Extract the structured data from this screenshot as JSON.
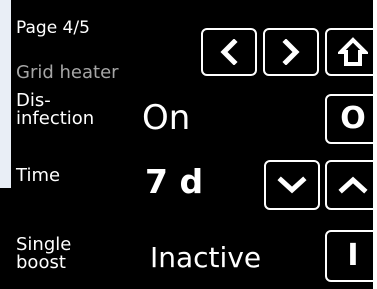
{
  "header": {
    "page_indicator": "Page 4/5",
    "title": "Grid heater"
  },
  "nav": {
    "prev_icon": "chevron-left-icon",
    "next_icon": "chevron-right-icon",
    "home_icon": "home-icon"
  },
  "settings": {
    "disinfection": {
      "label": "Dis-\ninfection",
      "value": "On",
      "button_label": "O"
    },
    "time": {
      "label": "Time",
      "value": "7 d",
      "decrease_icon": "chevron-down-icon",
      "increase_icon": "chevron-up-icon"
    },
    "single_boost": {
      "label": "Single\nboost",
      "value": "Inactive",
      "button_label": "I"
    }
  },
  "colors": {
    "background": "#000000",
    "text": "#ffffff",
    "title": "#a6a6a6",
    "border": "#ffffff"
  }
}
